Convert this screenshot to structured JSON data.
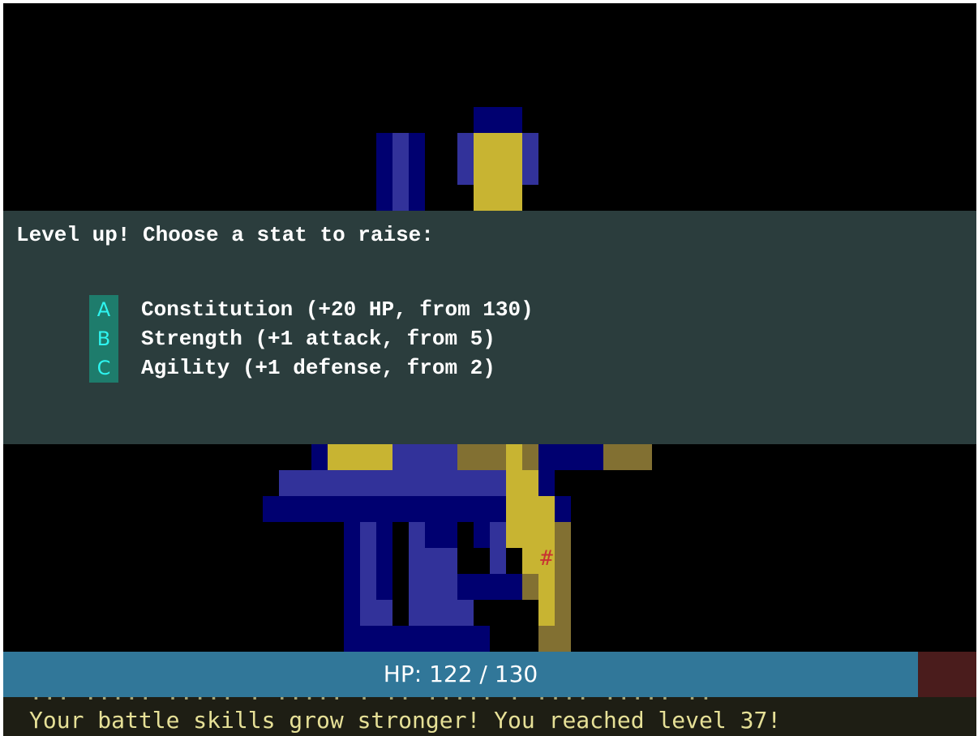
{
  "level_up": {
    "title": "Level up! Choose a stat to raise:",
    "options": [
      {
        "key": "A",
        "label": "Constitution (+20 HP, from 130)"
      },
      {
        "key": "B",
        "label": "Strength (+1 attack, from 5)"
      },
      {
        "key": "C",
        "label": "Agility (+1 defense, from 2)"
      }
    ]
  },
  "hp": {
    "current": 122,
    "max": 130,
    "text": "HP: 122 / 130",
    "fill_fraction": 0.94
  },
  "message_log": {
    "previous": "... ..... ..... . ..... . .. ..... . .... ..... ..",
    "latest": "Your battle skills grow stronger! You reached level 37!"
  },
  "map": {
    "colors": {
      "wall_dark": "#000070",
      "wall_lit": "#32329a",
      "floor_lit": "#c8b432",
      "floor_dark": "#827032",
      "item": "#c83232"
    },
    "items": [
      {
        "glyph": "#",
        "type": "scroll"
      }
    ]
  }
}
